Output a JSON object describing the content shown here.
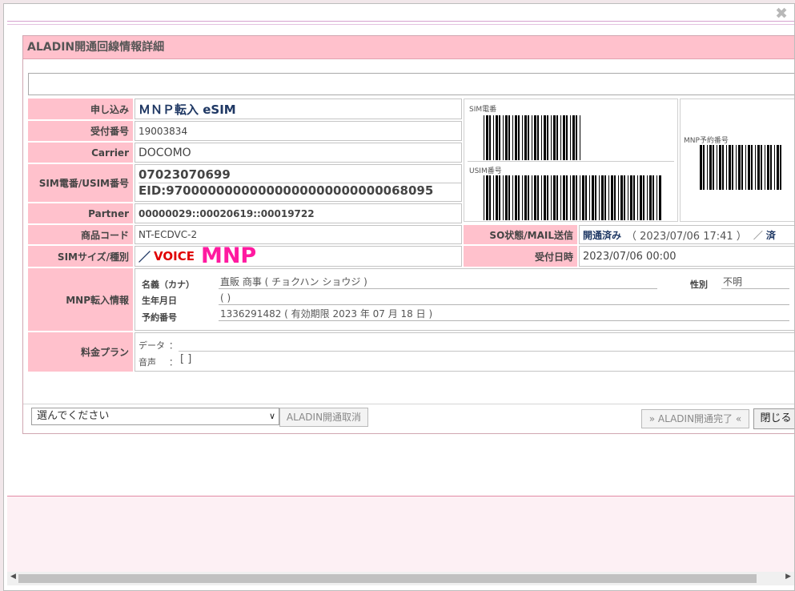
{
  "dialog": {
    "close_symbol": "✖"
  },
  "panel": {
    "title": "ALADIN開通回線情報詳細"
  },
  "fields": {
    "application": {
      "label": "申し込み",
      "value": "ＭＮＰ転入 eSIM"
    },
    "reception_no": {
      "label": "受付番号",
      "value": "19003834"
    },
    "carrier": {
      "label": "Carrier",
      "value": "DOCOMO"
    },
    "sim_usim": {
      "label": "SIM電番/USIM番号",
      "value_line1": "07023070699",
      "value_line2": "EID:97000000000000000000000000068095"
    },
    "partner": {
      "label": "Partner",
      "value": "00000029::00020619::00019722"
    },
    "product_code": {
      "label": "商品コード",
      "value": "NT-ECDVC-2"
    },
    "sim_size": {
      "label": "SIMサイズ/種別",
      "prefix": "／",
      "voice": "VOICE",
      "mnp": "MNP"
    },
    "so_status": {
      "label": "SO状態/MAIL送信",
      "status": "開通済み",
      "datetime": "（ 2023/07/06 17:41 ）",
      "sep": "／",
      "mail": "済"
    },
    "received_at": {
      "label": "受付日時",
      "value": "2023/07/06 00:00"
    },
    "mnp_info": {
      "label": "MNP転入情報",
      "name_label": "名義（カナ）",
      "name_value": "直販 商事 ( チョクハン ショウジ )",
      "gender_label": "性別",
      "gender_value": "不明",
      "birth_label": "生年月日",
      "birth_value": "( )",
      "reserve_label": "予約番号",
      "reserve_value": "1336291482 ( 有効期限 2023 年 07 月 18 日 )"
    },
    "plan": {
      "label": "料金プラン",
      "data_label": "データ",
      "data_sep": "：",
      "voice_label": "音声",
      "voice_sep": "：",
      "voice_value": "[ ]"
    }
  },
  "barcodes": {
    "sim_label": "SIM電番",
    "usim_label": "USIM番号",
    "mnp_label": "MNP予約番号"
  },
  "actions": {
    "select_value": "選んでください",
    "cancel_label": "ALADIN開通取消",
    "complete_label": "» ALADIN開通完了 «",
    "close_label": "閉じる"
  },
  "scrollbar": {
    "left_arrow": "◀",
    "right_arrow": "▶"
  }
}
